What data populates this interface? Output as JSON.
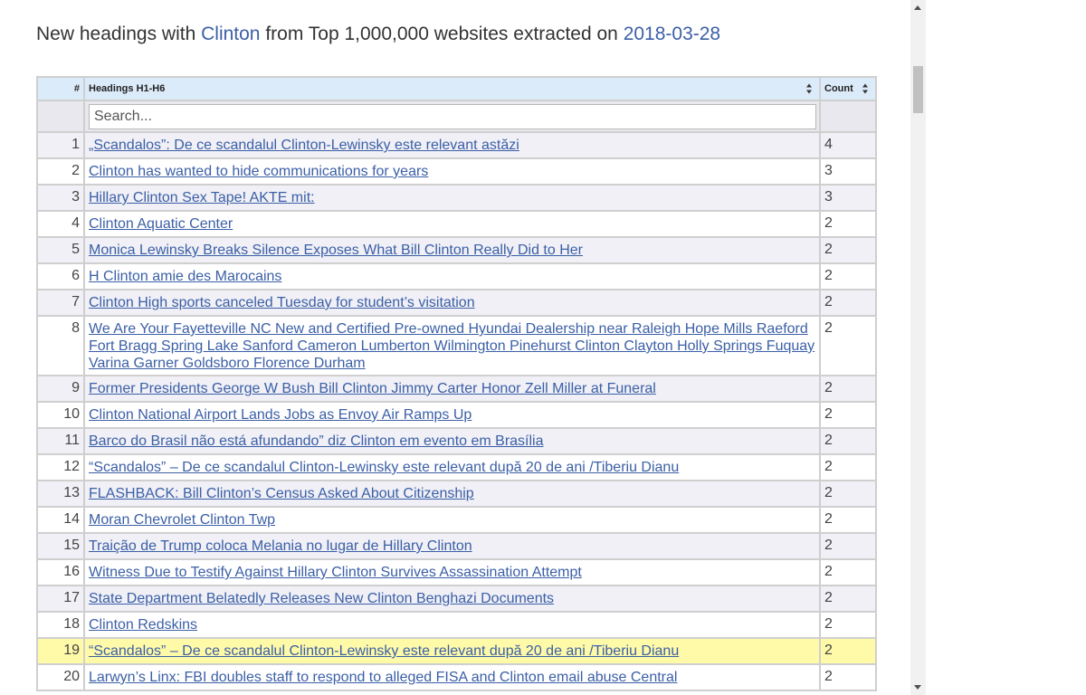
{
  "title": {
    "prefix": "New headings with",
    "keyword": "Clinton",
    "middle": "from Top 1,000,000 websites extracted on",
    "date": "2018-03-28"
  },
  "table": {
    "columns": {
      "num": "#",
      "heading": "Headings H1-H6",
      "count": "Count"
    },
    "search_placeholder": "Search...",
    "selected_row": 19,
    "rows": [
      {
        "n": "1",
        "heading": "„Scandalos”: De ce scandalul Clinton-Lewinsky este relevant astăzi",
        "count": "4"
      },
      {
        "n": "2",
        "heading": "Clinton has wanted to hide communications for years",
        "count": "3"
      },
      {
        "n": "3",
        "heading": "Hillary Clinton Sex Tape! AKTE mit:",
        "count": "3"
      },
      {
        "n": "4",
        "heading": "Clinton Aquatic Center",
        "count": "2"
      },
      {
        "n": "5",
        "heading": "Monica Lewinsky Breaks Silence Exposes What Bill Clinton Really Did to Her",
        "count": "2"
      },
      {
        "n": "6",
        "heading": "H Clinton amie des Marocains",
        "count": "2"
      },
      {
        "n": "7",
        "heading": "Clinton High sports canceled Tuesday for student’s visitation",
        "count": "2"
      },
      {
        "n": "8",
        "heading": "We Are Your Fayetteville NC New and Certified Pre-owned Hyundai Dealership near Raleigh Hope Mills Raeford Fort Bragg Spring Lake Sanford Cameron Lumberton Wilmington Pinehurst Clinton Clayton Holly Springs Fuquay Varina Garner Goldsboro Florence Durham",
        "count": "2"
      },
      {
        "n": "9",
        "heading": "Former Presidents George W Bush Bill Clinton Jimmy Carter Honor Zell Miller at Funeral",
        "count": "2"
      },
      {
        "n": "10",
        "heading": "Clinton National Airport Lands Jobs as Envoy Air Ramps Up",
        "count": "2"
      },
      {
        "n": "11",
        "heading": "Barco do Brasil não está afundando” diz Clinton em evento em Brasília",
        "count": "2"
      },
      {
        "n": "12",
        "heading": "“Scandalos” – De ce scandalul Clinton-Lewinsky este relevant după 20 de ani /Tiberiu Dianu",
        "count": "2"
      },
      {
        "n": "13",
        "heading": "FLASHBACK: Bill Clinton’s Census Asked About Citizenship",
        "count": "2"
      },
      {
        "n": "14",
        "heading": "Moran Chevrolet Clinton Twp",
        "count": "2"
      },
      {
        "n": "15",
        "heading": "Traição de Trump coloca Melania no lugar de Hillary Clinton",
        "count": "2"
      },
      {
        "n": "16",
        "heading": "Witness Due to Testify Against Hillary Clinton Survives Assassination Attempt",
        "count": "2"
      },
      {
        "n": "17",
        "heading": "State Department Belatedly Releases New Clinton Benghazi Documents",
        "count": "2"
      },
      {
        "n": "18",
        "heading": "Clinton Redskins",
        "count": "2"
      },
      {
        "n": "19",
        "heading": "“Scandalos” – De ce scandalul Clinton-Lewinsky este relevant după 20 de ani /Tiberiu Dianu",
        "count": "2"
      },
      {
        "n": "20",
        "heading": "Larwyn’s Linx: FBI doubles staff to respond to alleged FISA and Clinton email abuse Central",
        "count": "2"
      }
    ]
  },
  "icons": {
    "sort": "sort-icon",
    "scroll_up": "scroll-up-arrow-icon",
    "scroll_down": "scroll-down-arrow-icon"
  },
  "colors": {
    "link": "#3b5fa6",
    "header_bg": "#dcebfa",
    "row_alt_bg": "#f0f0f6",
    "selected_row_bg": "#fffaa8"
  }
}
